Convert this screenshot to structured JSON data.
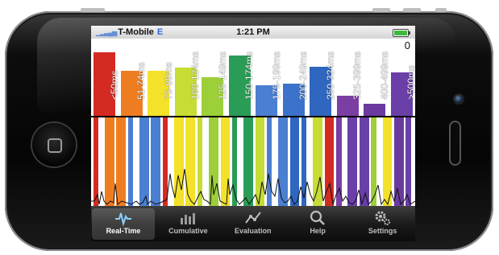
{
  "status_bar": {
    "carrier": "T-Mobile",
    "network": "E",
    "time": "1:21 PM"
  },
  "histogram": {
    "counter": "0",
    "bars": [
      {
        "label": "<50ms",
        "color": "#d42a22",
        "level": 0.82
      },
      {
        "label": "51-74ms",
        "color": "#ee7d22",
        "level": 0.58
      },
      {
        "label": "75-99ms",
        "color": "#f3e12a",
        "level": 0.58
      },
      {
        "label": "100-124ms",
        "color": "#c7dc34",
        "level": 0.62
      },
      {
        "label": "125-149ms",
        "color": "#9dcf39",
        "level": 0.5
      },
      {
        "label": "150-174ms",
        "color": "#2a9c55",
        "level": 0.78
      },
      {
        "label": "175-199ms",
        "color": "#4b7fd1",
        "level": 0.4
      },
      {
        "label": "200-249ms",
        "color": "#3c72c9",
        "level": 0.42
      },
      {
        "label": "250-324ms",
        "color": "#2f66c0",
        "level": 0.64
      },
      {
        "label": "325-399ms",
        "color": "#7b3ea3",
        "level": 0.26
      },
      {
        "label": "400-499ms",
        "color": "#6a3a9e",
        "level": 0.16
      },
      {
        "label": ">500ms",
        "color": "#6a3fa8",
        "level": 0.56
      }
    ]
  },
  "tabs": [
    {
      "label": "Real-Time",
      "icon": "pulse-icon",
      "active": true
    },
    {
      "label": "Cumulative",
      "icon": "bar-chart-icon",
      "active": false
    },
    {
      "label": "Evaluation",
      "icon": "trend-line-icon",
      "active": false
    },
    {
      "label": "Help",
      "icon": "search-icon",
      "active": false
    },
    {
      "label": "Settings",
      "icon": "gears-icon",
      "active": false
    }
  ]
}
